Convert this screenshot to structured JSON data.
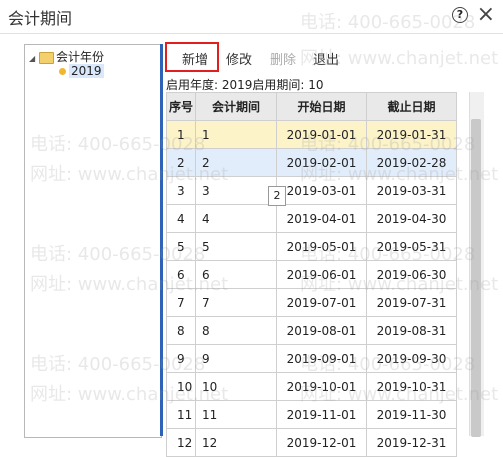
{
  "window": {
    "title": "会计期间",
    "help_label": "?",
    "close_label": "×"
  },
  "tree": {
    "root_label": "会计年份",
    "year_label": "2019"
  },
  "toolbar": {
    "add": "新增",
    "edit": "修改",
    "delete": "删除",
    "exit": "退出"
  },
  "info": {
    "text": "启用年度:  2019启用期间:  10"
  },
  "table": {
    "headers": [
      "序号",
      "会计期间",
      "开始日期",
      "截止日期"
    ],
    "rows": [
      [
        "1",
        "1",
        "2019-01-01",
        "2019-01-31"
      ],
      [
        "2",
        "2",
        "2019-02-01",
        "2019-02-28"
      ],
      [
        "3",
        "3",
        "2019-03-01",
        "2019-03-31"
      ],
      [
        "4",
        "4",
        "2019-04-01",
        "2019-04-30"
      ],
      [
        "5",
        "5",
        "2019-05-01",
        "2019-05-31"
      ],
      [
        "6",
        "6",
        "2019-06-01",
        "2019-06-30"
      ],
      [
        "7",
        "7",
        "2019-07-01",
        "2019-07-31"
      ],
      [
        "8",
        "8",
        "2019-08-01",
        "2019-08-31"
      ],
      [
        "9",
        "9",
        "2019-09-01",
        "2019-09-30"
      ],
      [
        "10",
        "10",
        "2019-10-01",
        "2019-10-31"
      ],
      [
        "11",
        "11",
        "2019-11-01",
        "2019-11-30"
      ],
      [
        "12",
        "12",
        "2019-12-01",
        "2019-12-31"
      ]
    ]
  },
  "tooltip": "2",
  "watermark": {
    "phone": "电话: 400-665-0028",
    "site": "网址: www.chanjet.net"
  },
  "colors": {
    "selection_box": "#e02020",
    "row_highlight_yellow": "#fcf3c9",
    "row_highlight_blue": "#e2edfb",
    "splitter": "#2f63b8"
  }
}
